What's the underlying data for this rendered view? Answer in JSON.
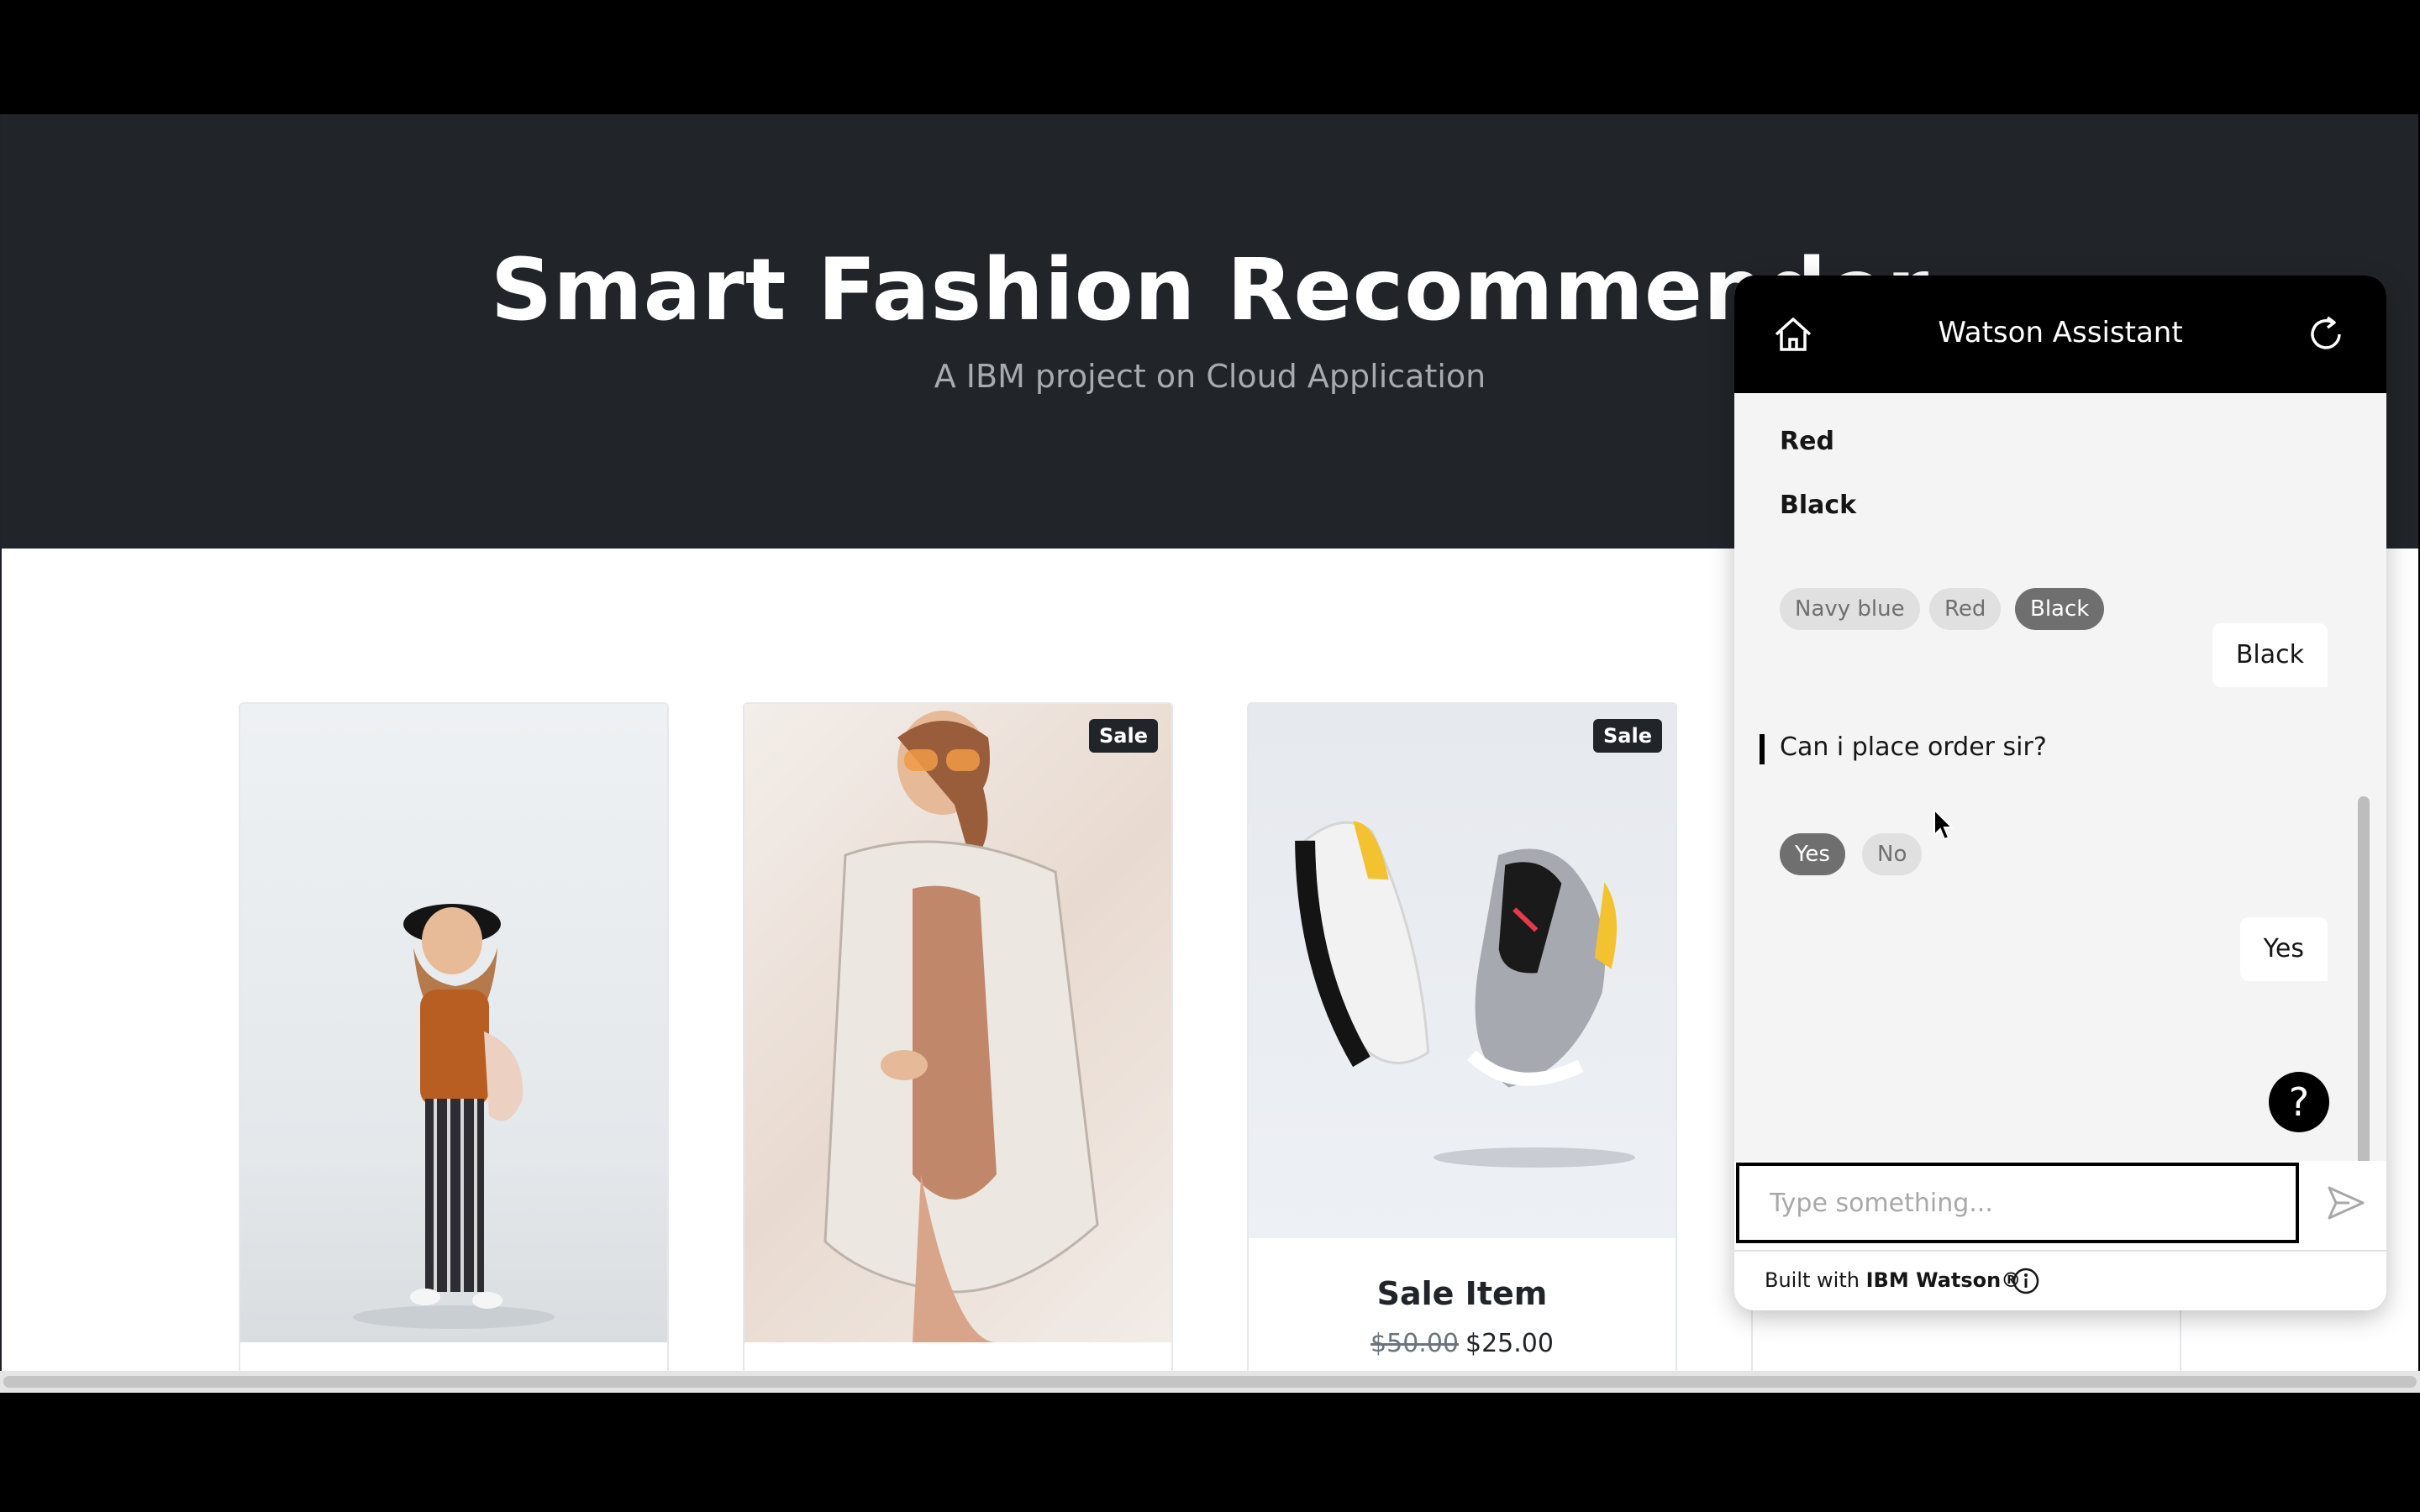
{
  "hero": {
    "title": "Smart Fashion Recommender",
    "subtitle": "A IBM project on Cloud Application"
  },
  "products": [
    {
      "badge": "",
      "title": "",
      "old_price": "",
      "price": ""
    },
    {
      "badge": "Sale",
      "title": "",
      "old_price": "",
      "price": ""
    },
    {
      "badge": "Sale",
      "title": "Sale Item",
      "old_price": "$50.00",
      "price": "$25.00"
    },
    {
      "badge": "",
      "title": "",
      "old_price": "",
      "price": ""
    }
  ],
  "chat": {
    "title": "Watson Assistant",
    "option_lines": [
      "Red",
      "Black"
    ],
    "color_chips": [
      {
        "label": "Navy blue",
        "selected": false
      },
      {
        "label": "Red",
        "selected": false
      },
      {
        "label": "Black",
        "selected": true
      }
    ],
    "user_reply_1": "Black",
    "bot_question": "Can i place order sir?",
    "answer_chips": [
      {
        "label": "Yes",
        "selected": true
      },
      {
        "label": "No",
        "selected": false
      }
    ],
    "user_reply_2": "Yes",
    "help_label": "?",
    "input_placeholder": "Type something...",
    "footer_prefix": "Built with ",
    "footer_brand": "IBM Watson®"
  },
  "icons": {
    "home": "home-icon",
    "restart": "restart-icon",
    "send": "send-icon",
    "info": "info-icon",
    "help": "help-icon"
  }
}
